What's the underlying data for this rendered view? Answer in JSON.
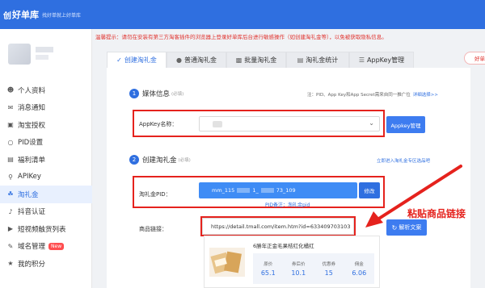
{
  "header": {
    "logo_mark": "创",
    "app_name": "好单库",
    "slogan": "找好单就上好单库"
  },
  "sidebar": {
    "items": [
      {
        "label": "个人资料",
        "icon": "user-icon"
      },
      {
        "label": "消息通知",
        "icon": "message-icon"
      },
      {
        "label": "淘宝授权",
        "icon": "taobao-icon"
      },
      {
        "label": "PID设置",
        "icon": "pid-icon"
      },
      {
        "label": "福利清单",
        "icon": "list-icon"
      },
      {
        "label": "APIKey",
        "icon": "key-icon"
      },
      {
        "label": "淘礼金",
        "icon": "gift-icon",
        "active": true
      },
      {
        "label": "抖音认证",
        "icon": "douyin-icon"
      },
      {
        "label": "短视频触货列表",
        "icon": "video-icon"
      },
      {
        "label": "域名管理",
        "icon": "domain-icon",
        "badge": "New"
      },
      {
        "label": "我的积分",
        "icon": "points-icon"
      }
    ]
  },
  "warning": "温馨提示：请勿在安装有第三方淘客插件的浏览器上登录好单库后台进行敏感操作（如创建淘礼金等），以免被获取隐私信息。",
  "tabs": [
    {
      "label": "创建淘礼金",
      "icon": "create-icon",
      "active": true
    },
    {
      "label": "普通淘礼金",
      "icon": "coin-icon"
    },
    {
      "label": "批量淘礼金",
      "icon": "batch-icon"
    },
    {
      "label": "淘礼金统计",
      "icon": "stats-icon"
    },
    {
      "label": "AppKey管理",
      "icon": "appkey-icon"
    }
  ],
  "top_right_pill": "好单",
  "section1": {
    "num": "1",
    "title": "媒体信息",
    "required": "(必填)",
    "note": "注：PID、App Key和App Secret需来自同一推广位",
    "note_link": "详细选择>>",
    "appkey_label": "AppKey名称：",
    "appkey_button": "Appkey管理"
  },
  "section2": {
    "num": "2",
    "title": "创建淘礼金",
    "required": "(必填)",
    "note_link": "立即进入淘礼金专区选品吧",
    "pid_label": "淘礼金PID：",
    "pid_value_prefix": "mm_115",
    "pid_value_mid1": "1_",
    "pid_value_mid2": "73_109",
    "pid_note": "PID备注：淘礼金pid",
    "modify_button": "修改",
    "link_label": "商品链接：",
    "link_value": "https://detail.tmall.com/item.htm?id=633409703103",
    "parse_button": "解析文案"
  },
  "product": {
    "title": "6勝年正金毛果桔红化橘红",
    "stats": [
      {
        "label": "原价",
        "value": "65.1"
      },
      {
        "label": "券后价",
        "value": "10.1"
      },
      {
        "label": "优惠券",
        "value": "15"
      },
      {
        "label": "佣金",
        "value": "6.06"
      }
    ]
  },
  "annotation": "粘贴商品链接",
  "colors": {
    "brand_blue": "#2f6fe0",
    "highlight_red": "#e5221d",
    "pid_blue": "#3f8cf5"
  }
}
